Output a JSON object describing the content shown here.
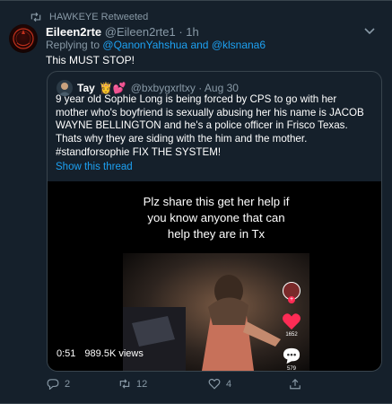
{
  "retweet": {
    "label": "HAWKEYE Retweeted"
  },
  "tweet": {
    "author_name": "Eileen2rte",
    "handle_time": "@Eileen2rte1 · 1h",
    "replying_prefix": "Replying to",
    "replying_user1": "@QanonYahshua",
    "replying_and": "and",
    "replying_user2": "@klsnana6",
    "text": "This MUST STOP!"
  },
  "quote": {
    "author_name": "Tay",
    "author_emoji": "👸💕",
    "handle_time": "@bxbygxrltxy · Aug 30",
    "text": "9 year old Sophie Long is being forced by CPS to go with her mother who's boyfriend is sexually abusing her his name is JACOB WAYNE BELLINGTON and he's a police officer in Frisco Texas. Thats why they are siding with the him and the mother. #standforsophie FIX THE SYSTEM!",
    "show_thread": "Show this thread"
  },
  "video": {
    "caption": "Plz share this get her help if you know anyone that can help they are in Tx",
    "likes": "1652",
    "comments": "579",
    "duration": "0:51",
    "views": "989.5K views"
  },
  "actions": {
    "replies": "2",
    "retweets": "12",
    "likes": "4"
  },
  "colors": {
    "background": "#15202b",
    "accent": "#1da1f2",
    "muted": "#8899a6",
    "border": "#38444d"
  }
}
